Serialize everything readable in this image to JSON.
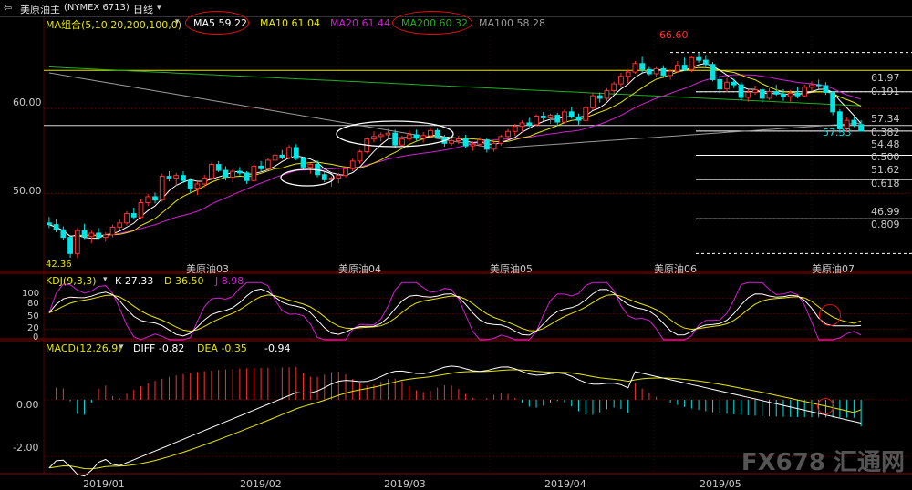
{
  "toolbar": {
    "back_icon": "back-arrow-icon",
    "instrument": "美原油主",
    "exchange_code": "(NYMEX 6713)",
    "period": "日线",
    "period_icon": "chevron-down-icon"
  },
  "main_panel": {
    "ma_group_label": "MA组合(5,10,20,200,100,0)",
    "ma_group_icon": "chevron-down-icon",
    "ma_readouts": [
      {
        "name": "MA5",
        "value": "59.22",
        "color": "#ffffff",
        "circled": true
      },
      {
        "name": "MA10",
        "value": "61.04",
        "color": "#e6e600",
        "circled": false
      },
      {
        "name": "MA20",
        "value": "61.44",
        "color": "#d020d0",
        "circled": false
      },
      {
        "name": "MA200",
        "value": "60.32",
        "color": "#20b020",
        "circled": true
      },
      {
        "name": "MA100",
        "value": "58.28",
        "color": "#9a9a9a",
        "circled": false
      }
    ],
    "y_ticks": [
      "60.00",
      "50.00"
    ],
    "high_label": "66.60",
    "low_label": "42.36",
    "last_label": "57.33",
    "fib_levels": [
      {
        "value": "61.97",
        "ratio": null
      },
      {
        "value": null,
        "ratio": "0.191"
      },
      {
        "value": "57.34",
        "ratio": null
      },
      {
        "value": null,
        "ratio": "0.382"
      },
      {
        "value": "54.48",
        "ratio": null
      },
      {
        "value": null,
        "ratio": "0.500"
      },
      {
        "value": "51.62",
        "ratio": null
      },
      {
        "value": null,
        "ratio": "0.618"
      },
      {
        "value": "46.99",
        "ratio": null
      },
      {
        "value": null,
        "ratio": "0.809"
      }
    ],
    "contract_labels": [
      "美原油03",
      "美原油04",
      "美原油05",
      "美原油06",
      "美原油07"
    ]
  },
  "kdj_panel": {
    "label": "KDJ(9,3,3)",
    "icon": "chevron-down-icon",
    "k": "K 27.33",
    "d": "D 36.50",
    "j": "J 8.98",
    "y_ticks": [
      "100",
      "80",
      "50",
      "20",
      "0"
    ]
  },
  "macd_panel": {
    "label": "MACD(12,26,9)",
    "icon": "chevron-down-icon",
    "diff": "DIFF -0.82",
    "dea": "DEA -0.35",
    "macd": "-0.94",
    "y_ticks": [
      "0.00",
      "-2.00"
    ]
  },
  "x_axis": [
    "2019/01",
    "2019/02",
    "2019/03",
    "2019/04",
    "2019/05"
  ],
  "watermark": "FX678 汇通网",
  "colors": {
    "up": "#ff3030",
    "down": "#00e5e5",
    "ma5": "#ffffff",
    "ma10": "#e6e600",
    "ma20": "#d020d0",
    "ma100": "#9a9a9a",
    "ma200": "#20b020",
    "highlight_ring": "#e01010"
  },
  "chart_data": {
    "type": "candlestick",
    "instrument": "美原油主 (NYMEX 6713)",
    "period": "日线",
    "ylim": [
      41,
      68.5
    ],
    "candles": [
      [
        46.5,
        47.2,
        45.9,
        46.3
      ],
      [
        46.3,
        47.0,
        45.4,
        45.7
      ],
      [
        45.7,
        46.1,
        44.5,
        44.8
      ],
      [
        44.8,
        45.1,
        42.4,
        42.9
      ],
      [
        42.9,
        45.9,
        42.36,
        45.6
      ],
      [
        45.6,
        46.4,
        44.6,
        44.9
      ],
      [
        44.9,
        45.6,
        44.1,
        45.3
      ],
      [
        45.3,
        45.9,
        44.6,
        44.8
      ],
      [
        44.8,
        45.4,
        44.3,
        45.1
      ],
      [
        45.1,
        46.3,
        44.8,
        46.0
      ],
      [
        46.0,
        46.9,
        45.7,
        46.5
      ],
      [
        46.5,
        47.9,
        46.2,
        47.6
      ],
      [
        47.6,
        48.3,
        46.9,
        47.2
      ],
      [
        47.2,
        49.3,
        47.0,
        48.9
      ],
      [
        48.9,
        49.9,
        48.5,
        49.6
      ],
      [
        49.6,
        50.1,
        48.8,
        49.2
      ],
      [
        49.2,
        52.3,
        49.0,
        52.0
      ],
      [
        52.0,
        52.6,
        51.4,
        51.8
      ],
      [
        51.8,
        52.4,
        50.9,
        52.1
      ],
      [
        52.1,
        52.6,
        51.2,
        51.5
      ],
      [
        51.5,
        51.8,
        50.1,
        50.6
      ],
      [
        50.6,
        51.4,
        49.8,
        51.1
      ],
      [
        51.1,
        52.2,
        50.7,
        51.8
      ],
      [
        51.8,
        53.6,
        51.5,
        53.4
      ],
      [
        53.4,
        53.8,
        52.5,
        52.7
      ],
      [
        52.7,
        53.2,
        51.5,
        51.9
      ],
      [
        51.9,
        52.8,
        51.3,
        52.6
      ],
      [
        52.6,
        53.1,
        52.1,
        52.4
      ],
      [
        52.4,
        52.6,
        51.1,
        51.5
      ],
      [
        51.5,
        53.4,
        51.4,
        53.2
      ],
      [
        53.2,
        53.8,
        52.6,
        52.9
      ],
      [
        52.9,
        54.1,
        52.7,
        53.9
      ],
      [
        53.9,
        54.8,
        53.6,
        54.5
      ],
      [
        54.5,
        55.1,
        54.0,
        54.2
      ],
      [
        54.2,
        55.7,
        54.0,
        55.4
      ],
      [
        55.4,
        55.8,
        53.9,
        54.1
      ],
      [
        54.1,
        54.3,
        52.8,
        53.1
      ],
      [
        53.1,
        53.6,
        52.3,
        53.4
      ],
      [
        53.4,
        53.9,
        51.9,
        52.2
      ],
      [
        52.2,
        52.5,
        51.3,
        51.6
      ],
      [
        51.6,
        52.0,
        50.8,
        51.8
      ],
      [
        51.8,
        52.4,
        51.2,
        52.1
      ],
      [
        52.1,
        53.2,
        51.9,
        52.9
      ],
      [
        52.9,
        54.1,
        52.6,
        53.8
      ],
      [
        53.8,
        55.1,
        53.5,
        54.9
      ],
      [
        54.9,
        56.6,
        54.7,
        56.4
      ],
      [
        56.4,
        57.3,
        56.0,
        56.7
      ],
      [
        56.7,
        57.2,
        56.1,
        56.9
      ],
      [
        56.9,
        57.6,
        56.4,
        57.1
      ],
      [
        57.1,
        57.5,
        55.4,
        55.7
      ],
      [
        55.7,
        56.8,
        55.5,
        56.4
      ],
      [
        56.4,
        57.4,
        56.1,
        56.9
      ],
      [
        56.9,
        57.5,
        56.2,
        56.5
      ],
      [
        56.5,
        57.2,
        56.0,
        56.8
      ],
      [
        56.8,
        57.8,
        56.6,
        57.4
      ],
      [
        57.4,
        57.7,
        56.5,
        56.6
      ],
      [
        56.6,
        56.9,
        55.5,
        55.9
      ],
      [
        55.9,
        56.5,
        55.6,
        56.2
      ],
      [
        56.2,
        56.8,
        55.8,
        56.4
      ],
      [
        56.4,
        56.9,
        55.3,
        55.6
      ],
      [
        55.6,
        56.1,
        55.0,
        55.8
      ],
      [
        55.8,
        56.6,
        55.5,
        56.3
      ],
      [
        56.3,
        56.5,
        54.8,
        55.2
      ],
      [
        55.2,
        56.1,
        54.9,
        55.9
      ],
      [
        55.9,
        56.9,
        55.6,
        56.7
      ],
      [
        56.7,
        57.6,
        56.3,
        57.3
      ],
      [
        57.3,
        58.2,
        56.8,
        57.9
      ],
      [
        57.9,
        58.6,
        57.2,
        58.3
      ],
      [
        58.3,
        58.9,
        57.8,
        58.1
      ],
      [
        58.1,
        59.3,
        57.9,
        59.1
      ],
      [
        59.1,
        59.6,
        58.5,
        58.9
      ],
      [
        58.9,
        59.4,
        58.2,
        59.2
      ],
      [
        59.2,
        59.5,
        57.9,
        58.4
      ],
      [
        58.4,
        59.9,
        58.2,
        59.6
      ],
      [
        59.6,
        60.2,
        58.8,
        59.0
      ],
      [
        59.0,
        59.4,
        58.1,
        58.6
      ],
      [
        58.6,
        60.3,
        58.5,
        60.1
      ],
      [
        60.1,
        61.8,
        59.8,
        61.5
      ],
      [
        61.5,
        61.9,
        60.7,
        61.2
      ],
      [
        61.2,
        62.4,
        60.9,
        62.1
      ],
      [
        62.1,
        63.2,
        61.7,
        62.9
      ],
      [
        62.9,
        64.2,
        62.6,
        63.8
      ],
      [
        63.8,
        64.6,
        63.0,
        64.3
      ],
      [
        64.3,
        65.6,
        64.1,
        65.3
      ],
      [
        65.3,
        66.1,
        64.2,
        64.6
      ],
      [
        64.6,
        64.9,
        63.9,
        64.1
      ],
      [
        64.1,
        64.9,
        63.7,
        64.7
      ],
      [
        64.7,
        65.1,
        63.6,
        63.9
      ],
      [
        63.9,
        64.6,
        63.4,
        64.4
      ],
      [
        64.4,
        65.6,
        64.2,
        65.1
      ],
      [
        65.1,
        66.0,
        64.4,
        64.6
      ],
      [
        64.6,
        66.2,
        64.3,
        66.0
      ],
      [
        66.0,
        66.6,
        65.4,
        65.7
      ],
      [
        65.7,
        66.3,
        64.9,
        65.2
      ],
      [
        65.2,
        65.5,
        63.2,
        63.4
      ],
      [
        63.4,
        63.9,
        61.8,
        62.3
      ],
      [
        62.3,
        63.6,
        61.9,
        63.1
      ],
      [
        63.1,
        63.5,
        62.4,
        62.8
      ],
      [
        62.8,
        63.1,
        60.9,
        61.3
      ],
      [
        61.3,
        62.2,
        60.8,
        61.9
      ],
      [
        61.9,
        62.7,
        61.6,
        62.2
      ],
      [
        62.2,
        62.5,
        60.7,
        61.2
      ],
      [
        61.2,
        62.4,
        61.0,
        62.0
      ],
      [
        62.0,
        62.8,
        61.5,
        61.7
      ],
      [
        61.7,
        62.3,
        60.9,
        61.4
      ],
      [
        61.4,
        62.2,
        60.8,
        61.8
      ],
      [
        61.8,
        62.5,
        61.2,
        61.5
      ],
      [
        61.5,
        62.8,
        61.3,
        62.5
      ],
      [
        62.5,
        63.2,
        62.0,
        62.8
      ],
      [
        62.8,
        63.4,
        62.3,
        62.7
      ],
      [
        62.7,
        63.1,
        61.6,
        61.9
      ],
      [
        61.9,
        62.0,
        59.2,
        59.6
      ],
      [
        59.6,
        59.9,
        57.1,
        57.6
      ],
      [
        57.6,
        58.9,
        57.2,
        58.6
      ],
      [
        58.6,
        59.0,
        57.8,
        58.1
      ],
      [
        58.1,
        58.6,
        57.3,
        57.33
      ]
    ],
    "moving_averages": {
      "MA5": 59.22,
      "MA10": 61.04,
      "MA20": 61.44,
      "MA200": 60.32,
      "MA100": 58.28
    },
    "fibonacci": {
      "high": 66.6,
      "low": 42.36,
      "levels": [
        61.97,
        57.34,
        54.48,
        51.62,
        46.99
      ],
      "ratios": [
        0.191,
        0.382,
        0.5,
        0.618,
        0.809
      ]
    },
    "reference_lines": [
      64.5,
      58.0
    ],
    "kdj": {
      "K": 27.33,
      "D": 36.5,
      "J": 8.98,
      "ylim": [
        0,
        100
      ]
    },
    "macd": {
      "DIFF": -0.82,
      "DEA": -0.35,
      "MACD": -0.94,
      "ylim": [
        -2.6,
        1.6
      ]
    },
    "x_labels": [
      "2019/01",
      "2019/02",
      "2019/03",
      "2019/04",
      "2019/05"
    ]
  }
}
